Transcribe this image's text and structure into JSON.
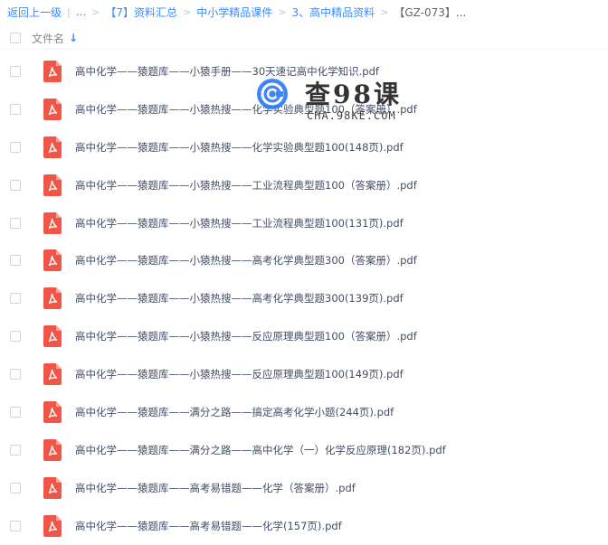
{
  "breadcrumb": {
    "back": "返回上一级",
    "divider": "|",
    "ellipsis": "...",
    "sep": ">",
    "items": [
      "【7】资料汇总",
      "中小学精品课件",
      "3、高中精品资料"
    ],
    "current": "【GZ-073】..."
  },
  "table": {
    "column_name": "文件名",
    "sort_icon": "↓"
  },
  "files": [
    "高中化学——猿题库——小猿手册——30天速记高中化学知识.pdf",
    "高中化学——猿题库——小猿热搜——化学实验典型题100（答案册）.pdf",
    "高中化学——猿题库——小猿热搜——化学实验典型题100(148页).pdf",
    "高中化学——猿题库——小猿热搜——工业流程典型题100（答案册）.pdf",
    "高中化学——猿题库——小猿热搜——工业流程典型题100(131页).pdf",
    "高中化学——猿题库——小猿热搜——高考化学典型题300（答案册）.pdf",
    "高中化学——猿题库——小猿热搜——高考化学典型题300(139页).pdf",
    "高中化学——猿题库——小猿热搜——反应原理典型题100（答案册）.pdf",
    "高中化学——猿题库——小猿热搜——反应原理典型题100(149页).pdf",
    "高中化学——猿题库——满分之路——搞定高考化学小题(244页).pdf",
    "高中化学——猿题库——满分之路——高中化学（一）化学反应原理(182页).pdf",
    "高中化学——猿题库——高考易错题——化学（答案册）.pdf",
    "高中化学——猿题库——高考易错题——化学(157页).pdf"
  ],
  "watermark": {
    "brand": "查98课",
    "url": "CHA.98KE.COM"
  },
  "colors": {
    "link": "#3b8cff",
    "pdf_red": "#f05548",
    "text": "#424e67"
  }
}
